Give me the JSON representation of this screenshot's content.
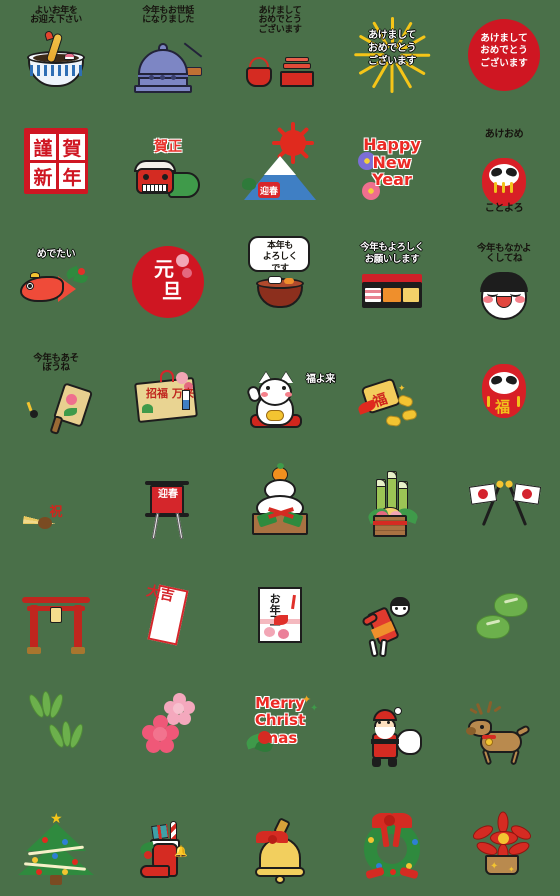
{
  "page": {
    "title": "New Year Emoji Sticker Sheet",
    "background_color": "#4a7049",
    "columns": 5,
    "rows": 8,
    "total_stickers": 40
  },
  "stickers": [
    {
      "id": 1,
      "row": 1,
      "col": 1,
      "name": "toshikoshi-soba-bowl",
      "caption": "よいお年を\nお迎え下さい",
      "caption_style": "black",
      "colors": {
        "bowl": "#eef4fb",
        "stripe": "#2f6fb5",
        "shrimp": "#e8a82e"
      }
    },
    {
      "id": 2,
      "row": 1,
      "col": 2,
      "name": "temple-bell-joya-no-kane",
      "caption": "今年もお世話\nになりました",
      "caption_style": "black",
      "colors": {
        "bell": "#7d86c4",
        "log": "#c07034"
      }
    },
    {
      "id": 3,
      "row": 1,
      "col": 3,
      "name": "red-lacquer-sake-set",
      "caption": "あけまして\nおめでとう\nございます",
      "caption_style": "black",
      "colors": {
        "lacquer": "#d52b22"
      }
    },
    {
      "id": 4,
      "row": 1,
      "col": 4,
      "name": "new-year-greeting-burst",
      "caption": "あけまして\nおめでとう\nございます",
      "caption_style": "white-outline",
      "colors": {
        "rays": "#f5c518"
      }
    },
    {
      "id": 5,
      "row": 1,
      "col": 5,
      "name": "red-circle-greeting-stamp",
      "caption": "あけまして\nおめでとう\nございます",
      "caption_style": "white-on-red",
      "colors": {
        "circle": "#cf1622"
      }
    },
    {
      "id": 6,
      "row": 2,
      "col": 1,
      "name": "kinga-shinnen-red-square",
      "caption": "",
      "caption_style": "none",
      "kanji": [
        "謹",
        "賀",
        "新",
        "年"
      ],
      "colors": {
        "square": "#cf1622",
        "kanji": "#cf1622"
      }
    },
    {
      "id": 7,
      "row": 2,
      "col": 2,
      "name": "shishimai-lion-dance",
      "caption": "賀正",
      "caption_style": "red-outline",
      "colors": {
        "head": "#d42b22",
        "body": "#3f9a4a"
      }
    },
    {
      "id": 8,
      "row": 2,
      "col": 3,
      "name": "mount-fuji-sunrise-geishun",
      "caption": "",
      "caption_style": "none",
      "label": "迎春",
      "colors": {
        "mountain": "#3f7fc4",
        "sun": "#e02a1e"
      }
    },
    {
      "id": 9,
      "row": 2,
      "col": 4,
      "name": "happy-new-year-flowers",
      "caption": "Happy\nNew\nYear",
      "caption_style": "red-latin",
      "colors": {
        "text": "#ec2a24",
        "flower_a": "#7b6ed6",
        "flower_b": "#ef6f8e"
      }
    },
    {
      "id": 10,
      "row": 2,
      "col": 5,
      "name": "daruma-akeome-kotoyoro",
      "caption": "あけおめ",
      "caption2": "ことよろ",
      "caption_style": "black",
      "colors": {
        "daruma": "#d81f26",
        "stripes": "#f2c21b"
      }
    },
    {
      "id": 11,
      "row": 3,
      "col": 1,
      "name": "red-sea-bream-medetai",
      "caption": "めでたい",
      "caption_style": "white-outline",
      "colors": {
        "fish": "#ef4b39",
        "leaf": "#2f8a3e"
      }
    },
    {
      "id": 12,
      "row": 3,
      "col": 2,
      "name": "ganjitsu-red-stamp",
      "caption": "",
      "caption_style": "none",
      "kanji": [
        "元",
        "旦"
      ],
      "colors": {
        "circle": "#cf1622",
        "plum": "#f0a9b6"
      }
    },
    {
      "id": 13,
      "row": 3,
      "col": 3,
      "name": "ozoni-bowl-speech",
      "caption": "本年も\nよろしく\nです",
      "caption_style": "bubble",
      "colors": {
        "bowl": "#8c2f1d"
      }
    },
    {
      "id": 14,
      "row": 3,
      "col": 4,
      "name": "osechi-jubako-box",
      "caption": "今年もよろしく\nお願いします",
      "caption_style": "white-outline",
      "colors": {
        "box": "#1d1d1d",
        "lid": "#cf2028"
      }
    },
    {
      "id": 15,
      "row": 3,
      "col": 5,
      "name": "otafuku-smiling-face",
      "caption": "今年もなかよ\nくしてね",
      "caption_style": "black",
      "colors": {
        "face": "#ffffff",
        "hair": "#1d1d1d",
        "cheek": "#f4808a"
      }
    },
    {
      "id": 16,
      "row": 4,
      "col": 1,
      "name": "hagoita-battledore",
      "caption": "今年もあそ\nぼうね",
      "caption_style": "black",
      "colors": {
        "board": "#e8cf8f"
      }
    },
    {
      "id": 17,
      "row": 4,
      "col": 2,
      "name": "ema-wooden-plaque",
      "caption": "",
      "caption_style": "none",
      "label": "招福 万来",
      "colors": {
        "board": "#e9d492",
        "cord": "#d5262b"
      }
    },
    {
      "id": 18,
      "row": 4,
      "col": 3,
      "name": "maneki-neko-lucky-cat",
      "caption": "福よ来い",
      "caption_style": "white-outline",
      "colors": {
        "cat": "#ffffff",
        "koban": "#f3c431"
      }
    },
    {
      "id": 19,
      "row": 4,
      "col": 4,
      "name": "fukubukuro-lucky-bag",
      "caption": "",
      "caption_style": "none",
      "label": "福",
      "colors": {
        "bag": "#f3cd5c",
        "coin": "#f3c431"
      }
    },
    {
      "id": 20,
      "row": 4,
      "col": 5,
      "name": "daruma-fuku",
      "caption": "",
      "caption_style": "none",
      "label": "福",
      "colors": {
        "daruma": "#d81f26",
        "fuku": "#f2c21b"
      }
    },
    {
      "id": 21,
      "row": 5,
      "col": 1,
      "name": "golden-folding-fan-iwai",
      "caption": "",
      "caption_style": "none",
      "label": "祝",
      "colors": {
        "fan": "#f2d98b",
        "kanji": "#d0261d"
      }
    },
    {
      "id": 22,
      "row": 5,
      "col": 2,
      "name": "geishun-banner-flag",
      "caption": "",
      "caption_style": "none",
      "label": "迎春",
      "colors": {
        "flag": "#d5262b"
      }
    },
    {
      "id": 23,
      "row": 5,
      "col": 3,
      "name": "kagami-mochi",
      "caption": "",
      "caption_style": "none",
      "colors": {
        "mochi": "#ffffff",
        "orange": "#f0901e",
        "tray": "#a97242"
      }
    },
    {
      "id": 24,
      "row": 5,
      "col": 4,
      "name": "kadomatsu-pine-decoration",
      "caption": "",
      "caption_style": "none",
      "colors": {
        "bamboo": "#9cc455",
        "pot": "#a97242"
      }
    },
    {
      "id": 25,
      "row": 5,
      "col": 5,
      "name": "crossed-japanese-flags",
      "caption": "",
      "caption_style": "none",
      "colors": {
        "flag": "#ffffff",
        "disc": "#d4232e"
      }
    },
    {
      "id": 26,
      "row": 6,
      "col": 1,
      "name": "torii-gate",
      "caption": "",
      "caption_style": "none",
      "colors": {
        "gate": "#c0261e",
        "lantern": "#f5dc8c"
      }
    },
    {
      "id": 27,
      "row": 6,
      "col": 2,
      "name": "omikuji-daikichi",
      "caption": "",
      "caption_style": "none",
      "label": "大吉",
      "colors": {
        "paper": "#ffffff",
        "border": "#d5262b"
      }
    },
    {
      "id": 28,
      "row": 6,
      "col": 3,
      "name": "otoshidama-envelope",
      "caption": "",
      "caption_style": "none",
      "label": "お年玉",
      "colors": {
        "envelope": "#ffffff",
        "plum": "#f4b9bf"
      }
    },
    {
      "id": 29,
      "row": 6,
      "col": 4,
      "name": "hanetsuki-kimono-child",
      "caption": "",
      "caption_style": "none",
      "colors": {
        "kimono": "#e03a2e",
        "obi": "#ef8f2c"
      }
    },
    {
      "id": 30,
      "row": 6,
      "col": 5,
      "name": "pine-needle-sprigs",
      "caption": "",
      "caption_style": "none",
      "colors": {
        "pine": "#6cb04c"
      }
    },
    {
      "id": 31,
      "row": 7,
      "col": 1,
      "name": "bamboo-leaves",
      "caption": "",
      "caption_style": "none",
      "colors": {
        "leaf": "#6cb04c"
      }
    },
    {
      "id": 32,
      "row": 7,
      "col": 2,
      "name": "plum-blossoms",
      "caption": "",
      "caption_style": "none",
      "colors": {
        "dark_pink": "#ef5878",
        "light_pink": "#f4a8bd"
      }
    },
    {
      "id": 33,
      "row": 7,
      "col": 3,
      "name": "merry-christmas-text",
      "caption": "Merry\nChrist\nmas",
      "caption_style": "red-latin",
      "colors": {
        "text": "#ec2a24",
        "holly": "#2f8a3e"
      }
    },
    {
      "id": 34,
      "row": 7,
      "col": 4,
      "name": "santa-claus",
      "caption": "",
      "caption_style": "none",
      "colors": {
        "suit": "#d52b22",
        "sack": "#ffffff"
      }
    },
    {
      "id": 35,
      "row": 7,
      "col": 5,
      "name": "reindeer",
      "caption": "",
      "caption_style": "none",
      "colors": {
        "body": "#b98a4e",
        "collar": "#d52b22",
        "bell": "#f3c431"
      }
    },
    {
      "id": 36,
      "row": 8,
      "col": 1,
      "name": "christmas-tree",
      "caption": "",
      "caption_style": "none",
      "colors": {
        "tree": "#2f8a3e",
        "star": "#f5c518",
        "trunk": "#7a4b22"
      }
    },
    {
      "id": 37,
      "row": 8,
      "col": 2,
      "name": "christmas-stocking",
      "caption": "",
      "caption_style": "none",
      "colors": {
        "sock": "#d52b22",
        "cuff": "#ffffff",
        "gift": "#3fa0a6"
      }
    },
    {
      "id": 38,
      "row": 8,
      "col": 3,
      "name": "christmas-bell",
      "caption": "",
      "caption_style": "none",
      "colors": {
        "bell": "#f2cf5e",
        "ribbon": "#d52b22"
      }
    },
    {
      "id": 39,
      "row": 8,
      "col": 4,
      "name": "christmas-wreath",
      "caption": "",
      "caption_style": "none",
      "colors": {
        "wreath": "#2f8a3e",
        "ribbon": "#d52b22"
      }
    },
    {
      "id": 40,
      "row": 8,
      "col": 5,
      "name": "poinsettia-plant",
      "caption": "",
      "caption_style": "none",
      "colors": {
        "flower": "#d52b22",
        "pot": "#b98a4e"
      }
    }
  ]
}
